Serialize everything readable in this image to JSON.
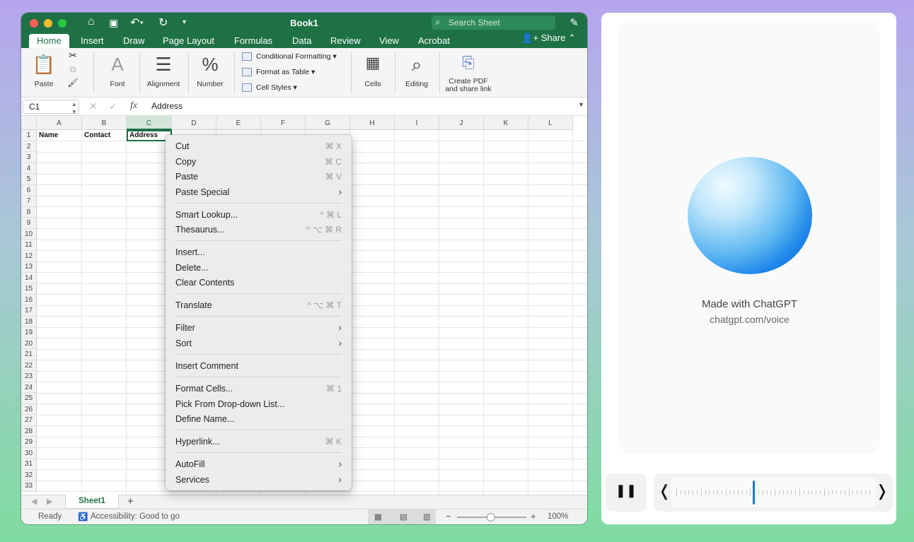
{
  "window": {
    "title": "Book1"
  },
  "search": {
    "placeholder": "Search Sheet"
  },
  "tabs": {
    "home": "Home",
    "insert": "Insert",
    "draw": "Draw",
    "layout": "Page Layout",
    "formulas": "Formulas",
    "data": "Data",
    "review": "Review",
    "view": "View",
    "acrobat": "Acrobat",
    "share": "Share"
  },
  "ribbon": {
    "paste": "Paste",
    "font": "Font",
    "alignment": "Alignment",
    "number": "Number",
    "cond": "Conditional Formatting",
    "table": "Format as Table",
    "styles": "Cell Styles",
    "cells": "Cells",
    "editing": "Editing",
    "pdf1": "Create PDF",
    "pdf2": "and share link"
  },
  "formula": {
    "namebox": "C1",
    "fx": "fx",
    "value": "Address"
  },
  "columns": [
    "A",
    "B",
    "C",
    "D",
    "E",
    "F",
    "G",
    "H",
    "I",
    "J",
    "K",
    "L"
  ],
  "rows": [
    "1",
    "2",
    "3",
    "4",
    "5",
    "6",
    "7",
    "8",
    "9",
    "10",
    "11",
    "12",
    "13",
    "14",
    "15",
    "16",
    "17",
    "18",
    "19",
    "20",
    "21",
    "22",
    "23",
    "24",
    "25",
    "26",
    "27",
    "28",
    "29",
    "30",
    "31",
    "32",
    "33"
  ],
  "cells": {
    "a1": "Name",
    "b1": "Contact",
    "c1": "Address"
  },
  "menu": {
    "cut": "Cut",
    "cut_sc": "⌘ X",
    "copy": "Copy",
    "copy_sc": "⌘ C",
    "paste": "Paste",
    "paste_sc": "⌘ V",
    "paste_special": "Paste Special",
    "smart": "Smart Lookup...",
    "smart_sc": "^ ⌘ L",
    "thes": "Thesaurus...",
    "thes_sc": "^ ⌥ ⌘ R",
    "insert": "Insert...",
    "delete": "Delete...",
    "clear": "Clear Contents",
    "translate": "Translate",
    "translate_sc": "^ ⌥ ⌘ T",
    "filter": "Filter",
    "sort": "Sort",
    "comment": "Insert Comment",
    "format": "Format Cells...",
    "format_sc": "⌘ 1",
    "pick": "Pick From Drop-down List...",
    "define": "Define Name...",
    "hyperlink": "Hyperlink...",
    "hyperlink_sc": "⌘ K",
    "autofill": "AutoFill",
    "services": "Services"
  },
  "sheet": {
    "tab": "Sheet1"
  },
  "status": {
    "ready": "Ready",
    "access": "Accessibility: Good to go",
    "zoom": "100%"
  },
  "panel": {
    "made": "Made with ChatGPT",
    "url": "chatgpt.com/voice"
  },
  "slider": {
    "position": 0.4
  },
  "colors": {
    "excel_green": "#1e7145",
    "accent_blue": "#1a73e8"
  }
}
